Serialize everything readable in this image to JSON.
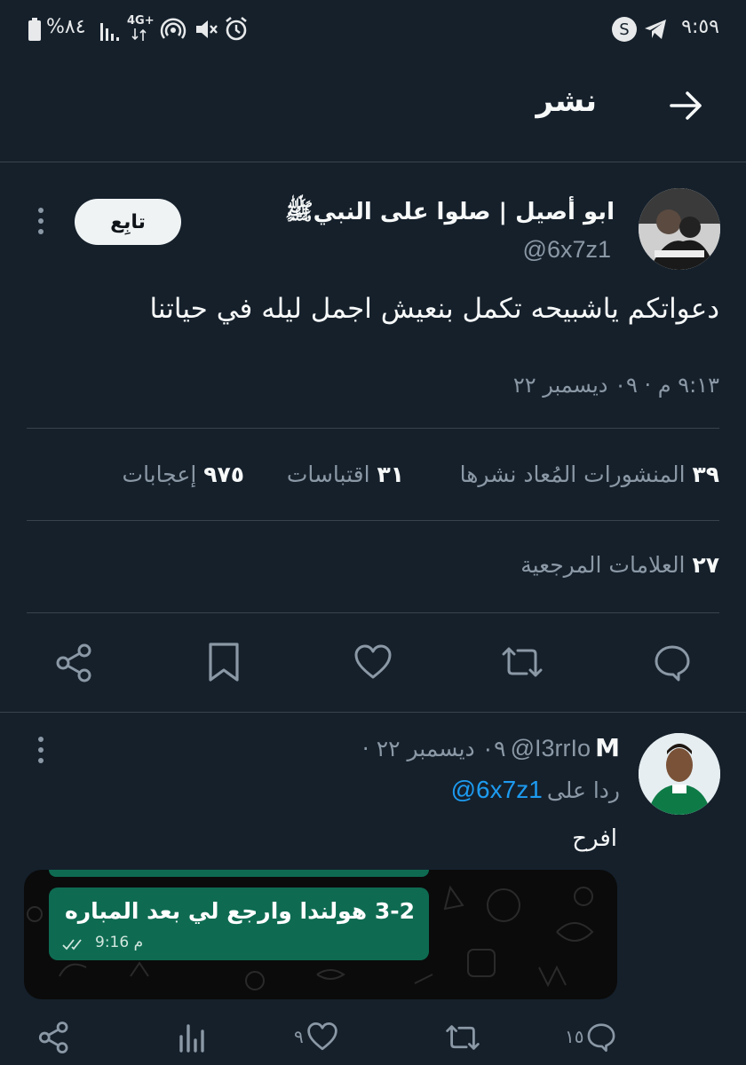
{
  "status_bar": {
    "time": "٩:٥٩",
    "battery_text": "%٨٤",
    "network": "4G+",
    "icons": [
      "s-app-icon",
      "telegram-icon",
      "battery-icon",
      "signal-icon",
      "hotspot-icon",
      "mute-icon",
      "alarm-icon"
    ]
  },
  "header": {
    "title": "نشر",
    "back_icon": "arrow-right-icon"
  },
  "tweet": {
    "author_name": "ابو أصيل | صلوا على النبيﷺ",
    "handle": "@6x7z1",
    "follow_label": "تابِع",
    "text": "دعواتكم ياشبيحه تكمل بنعيش اجمل ليله في حياتنا",
    "timestamp": "٩:١٣ م · ٠٩ ديسمبر ٢٢",
    "stats": {
      "reposts_count": "٣٩",
      "reposts_label": "المنشورات المُعاد نشرها",
      "quotes_count": "٣١",
      "quotes_label": "اقتباسات",
      "likes_count": "٩٧٥",
      "likes_label": "إعجابات",
      "bookmarks_count": "٢٧",
      "bookmarks_label": "العلامات المرجعية"
    },
    "actions": [
      "reply-icon",
      "repost-icon",
      "like-icon",
      "bookmark-icon",
      "share-icon"
    ]
  },
  "reply": {
    "author_name": "M",
    "handle": "@I3rrIo",
    "date": "· ٠٩ ديسمبر ٢٢",
    "replying_label": "ردا على",
    "replying_to": "@6x7z1",
    "text": "افرح",
    "media": {
      "bubble_text": "3-2 هولندا وارجع لي بعد المباره",
      "bubble_time": "9:16 م"
    },
    "actions": {
      "reply_count": "١٥",
      "like_count": "٩"
    }
  },
  "colors": {
    "background": "#15202b",
    "accent": "#1d9bf0",
    "muted": "#8b98a5",
    "divider": "#38444d",
    "bubble": "#0e6b52"
  }
}
